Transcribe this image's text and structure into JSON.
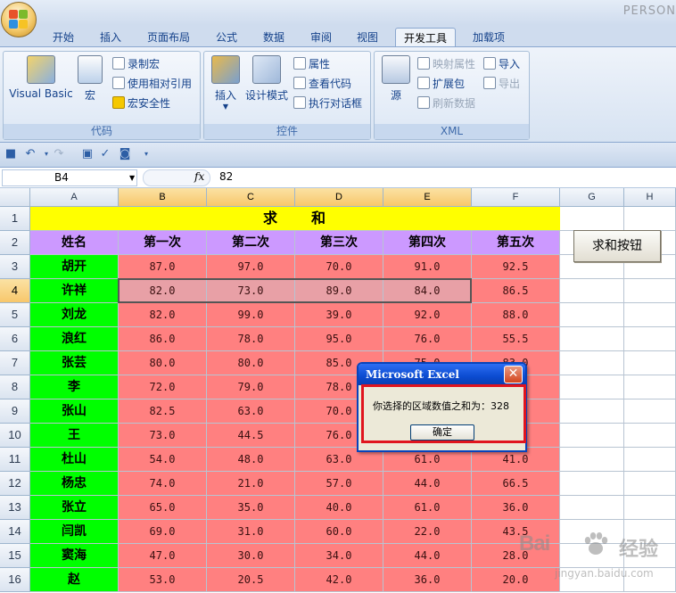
{
  "app": {
    "title": "PERSON"
  },
  "tabs": [
    {
      "label": "开始",
      "active": false
    },
    {
      "label": "插入",
      "active": false
    },
    {
      "label": "页面布局",
      "active": false
    },
    {
      "label": "公式",
      "active": false
    },
    {
      "label": "数据",
      "active": false
    },
    {
      "label": "审阅",
      "active": false
    },
    {
      "label": "视图",
      "active": false
    },
    {
      "label": "开发工具",
      "active": true
    },
    {
      "label": "加载项",
      "active": false
    }
  ],
  "ribbon": {
    "code": {
      "title": "代码",
      "visual_basic": "Visual Basic",
      "macro": "宏",
      "record_macro": "录制宏",
      "relative_ref": "使用相对引用",
      "macro_security": "宏安全性"
    },
    "controls": {
      "title": "控件",
      "insert": "插入",
      "design_mode": "设计模式",
      "properties": "属性",
      "view_code": "查看代码",
      "run_dialog": "执行对话框"
    },
    "xml": {
      "title": "XML",
      "source": "源",
      "map_properties": "映射属性",
      "expansion_packs": "扩展包",
      "refresh_data": "刷新数据",
      "import": "导入",
      "export": "导出"
    }
  },
  "formula_bar": {
    "name_box": "B4",
    "fx": "fx",
    "value": "82"
  },
  "columns": [
    "A",
    "B",
    "C",
    "D",
    "E",
    "F",
    "G",
    "H"
  ],
  "rows": [
    "1",
    "2",
    "3",
    "4",
    "5",
    "6",
    "7",
    "8",
    "9",
    "10",
    "11",
    "12",
    "13",
    "14",
    "15",
    "16"
  ],
  "sheet": {
    "title": "求　　和",
    "headers": [
      "姓名",
      "第一次",
      "第二次",
      "第三次",
      "第四次",
      "第五次"
    ],
    "data": [
      [
        "胡开",
        "87.0",
        "97.0",
        "70.0",
        "91.0",
        "92.5"
      ],
      [
        "许祥",
        "82.0",
        "73.0",
        "89.0",
        "84.0",
        "86.5"
      ],
      [
        "刘龙",
        "82.0",
        "99.0",
        "39.0",
        "92.0",
        "88.0"
      ],
      [
        "浪红",
        "86.0",
        "78.0",
        "95.0",
        "76.0",
        "55.5"
      ],
      [
        "张芸",
        "80.0",
        "80.0",
        "85.0",
        "75.0",
        "83.0"
      ],
      [
        "李",
        "72.0",
        "79.0",
        "78.0",
        "",
        ""
      ],
      [
        "张山",
        "82.5",
        "63.0",
        "70.0",
        "",
        ""
      ],
      [
        "王",
        "73.0",
        "44.5",
        "76.0",
        "",
        ""
      ],
      [
        "杜山",
        "54.0",
        "48.0",
        "63.0",
        "61.0",
        "41.0"
      ],
      [
        "杨忠",
        "74.0",
        "21.0",
        "57.0",
        "44.0",
        "66.5"
      ],
      [
        "张立",
        "65.0",
        "35.0",
        "40.0",
        "61.0",
        "36.0"
      ],
      [
        "闫凯",
        "69.0",
        "31.0",
        "60.0",
        "22.0",
        "43.5"
      ],
      [
        "窦海",
        "47.0",
        "30.0",
        "34.0",
        "44.0",
        "28.0"
      ],
      [
        "赵",
        "53.0",
        "20.5",
        "42.0",
        "36.0",
        "20.0"
      ]
    ]
  },
  "sum_button": "求和按钮",
  "dialog": {
    "title": "Microsoft Excel",
    "message": "你选择的区域数值之和为：328",
    "ok": "确定"
  },
  "watermark": {
    "brand": "Bai",
    "brand_cn": "经验",
    "url": "jingyan.baidu.com"
  },
  "colors": {
    "title_bg": "#ffff00",
    "header_bg": "#cc99ff",
    "name_bg": "#00ff00",
    "value_bg": "#ff8080",
    "selected_bg": "#e8a0a6"
  }
}
